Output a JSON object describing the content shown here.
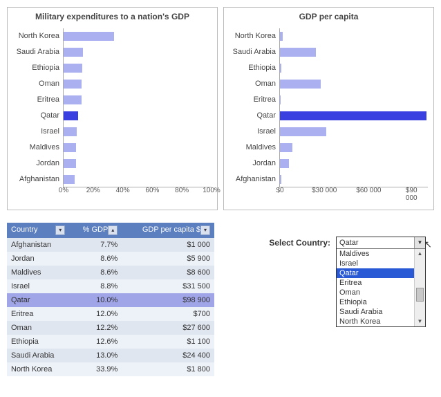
{
  "selected_country": "Qatar",
  "chart_data": [
    {
      "type": "bar",
      "orientation": "horizontal",
      "title": "Military expenditures to a nation's GDP",
      "categories": [
        "North Korea",
        "Saudi Arabia",
        "Ethiopia",
        "Oman",
        "Eritrea",
        "Qatar",
        "Israel",
        "Maldives",
        "Jordan",
        "Afghanistan"
      ],
      "values": [
        33.9,
        13.0,
        12.6,
        12.2,
        12.0,
        10.0,
        8.8,
        8.6,
        8.6,
        7.7
      ],
      "highlighted": "Qatar",
      "xlabel": "",
      "ylabel": "",
      "xlim": [
        0,
        100
      ],
      "xticks": [
        "0%",
        "20%",
        "40%",
        "60%",
        "80%",
        "100%"
      ]
    },
    {
      "type": "bar",
      "orientation": "horizontal",
      "title": "GDP per capita",
      "categories": [
        "North Korea",
        "Saudi Arabia",
        "Ethiopia",
        "Oman",
        "Eritrea",
        "Qatar",
        "Israel",
        "Maldives",
        "Jordan",
        "Afghanistan"
      ],
      "values": [
        1800,
        24400,
        1100,
        27600,
        700,
        98900,
        31500,
        8600,
        5900,
        1000
      ],
      "highlighted": "Qatar",
      "xlabel": "",
      "ylabel": "",
      "xlim": [
        0,
        100000
      ],
      "xticks": [
        "$0",
        "$30 000",
        "$60 000",
        "$90 000"
      ]
    }
  ],
  "table": {
    "columns": [
      "Country",
      "% GDP",
      "GDP per capita $"
    ],
    "rows": [
      {
        "country": "Afghanistan",
        "pct": "7.7%",
        "gdp": "$1 000"
      },
      {
        "country": "Jordan",
        "pct": "8.6%",
        "gdp": "$5 900"
      },
      {
        "country": "Maldives",
        "pct": "8.6%",
        "gdp": "$8 600"
      },
      {
        "country": "Israel",
        "pct": "8.8%",
        "gdp": "$31 500"
      },
      {
        "country": "Qatar",
        "pct": "10.0%",
        "gdp": "$98 900"
      },
      {
        "country": "Eritrea",
        "pct": "12.0%",
        "gdp": "$700"
      },
      {
        "country": "Oman",
        "pct": "12.2%",
        "gdp": "$27 600"
      },
      {
        "country": "Ethiopia",
        "pct": "12.6%",
        "gdp": "$1 100"
      },
      {
        "country": "Saudi Arabia",
        "pct": "13.0%",
        "gdp": "$24 400"
      },
      {
        "country": "North Korea",
        "pct": "33.9%",
        "gdp": "$1 800"
      }
    ]
  },
  "selector": {
    "label": "Select Country:",
    "current": "Qatar",
    "options": [
      "Maldives",
      "Israel",
      "Qatar",
      "Eritrea",
      "Oman",
      "Ethiopia",
      "Saudi Arabia",
      "North Korea"
    ]
  }
}
